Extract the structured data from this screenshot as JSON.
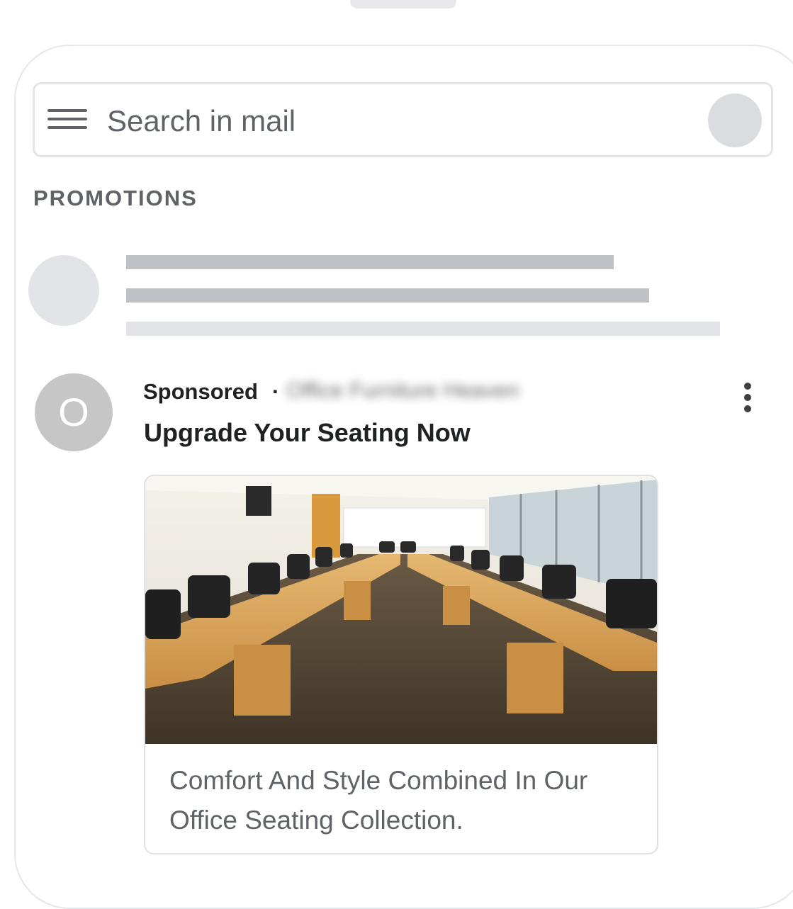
{
  "search": {
    "placeholder": "Search in mail"
  },
  "section": {
    "label": "PROMOTIONS"
  },
  "ad": {
    "avatar_letter": "O",
    "sponsored_label": "Sponsored",
    "separator": "·",
    "advertiser": "Office Furniture Heaven",
    "title": "Upgrade Your Seating Now",
    "description": "Comfort And Style Combined In Our Office Seating Collection.",
    "image": "conference-room-photo"
  },
  "icons": {
    "menu": "hamburger-menu-icon",
    "more": "vertical-ellipsis-icon"
  },
  "colors": {
    "placeholder_dark": "#bec1c6",
    "placeholder_light": "#e3e4e7",
    "avatar_gray": "#c6c6c6"
  }
}
